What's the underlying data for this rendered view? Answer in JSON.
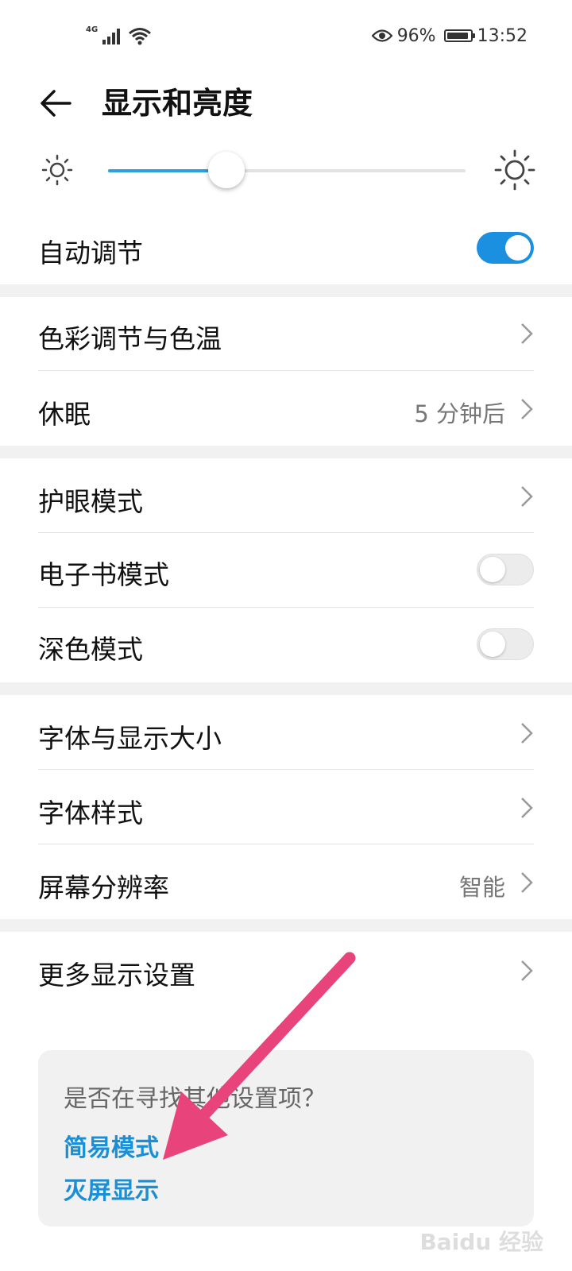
{
  "status_bar": {
    "network": "4G",
    "battery_percent": "96%",
    "time": "13:52",
    "battery_level": 0.96
  },
  "header": {
    "title": "显示和亮度"
  },
  "brightness": {
    "level": 0.33
  },
  "auto_adjust": {
    "label": "自动调节",
    "on": true
  },
  "group1": {
    "color": {
      "label": "色彩调节与色温"
    },
    "sleep": {
      "label": "休眠",
      "value": "5 分钟后"
    }
  },
  "group2": {
    "eye": {
      "label": "护眼模式"
    },
    "ebook": {
      "label": "电子书模式",
      "on": false
    },
    "dark": {
      "label": "深色模式",
      "on": false
    }
  },
  "group3": {
    "font_size": {
      "label": "字体与显示大小"
    },
    "font_style": {
      "label": "字体样式"
    },
    "resolution": {
      "label": "屏幕分辨率",
      "value": "智能"
    }
  },
  "more": {
    "label": "更多显示设置"
  },
  "suggest": {
    "title": "是否在寻找其他设置项？",
    "links": [
      "简易模式",
      "灭屏显示"
    ]
  },
  "watermark": "Baidu 经验",
  "colors": {
    "accent": "#1b8fe0",
    "link": "#1a8fd6",
    "arrow": "#e8437a"
  }
}
